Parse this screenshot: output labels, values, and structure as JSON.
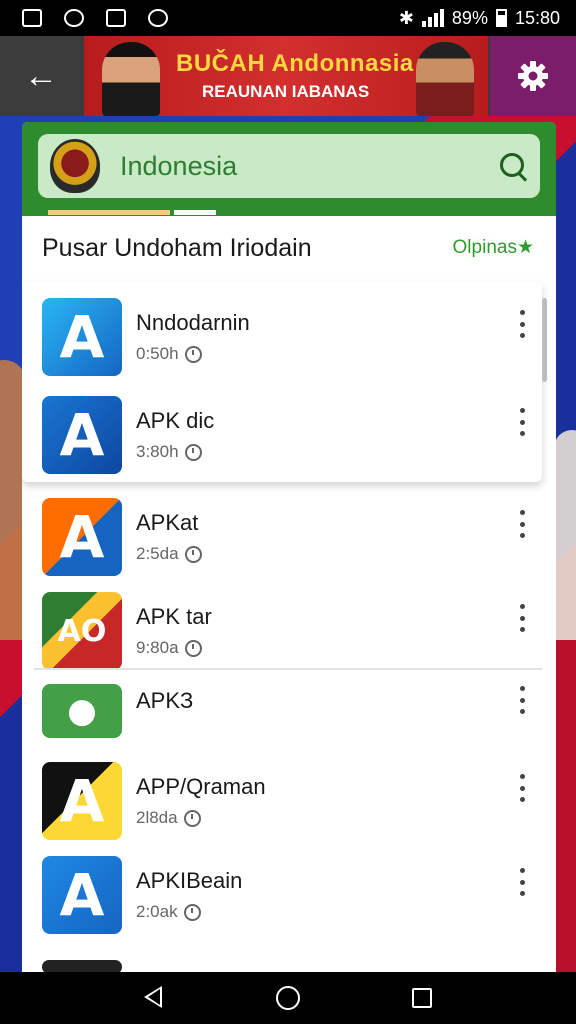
{
  "status_bar": {
    "battery_text": "89%",
    "time": "15:80"
  },
  "app_bar": {
    "banner_title": "BUČAH Andonnasia",
    "banner_subtitle": "REAUNAN IABANAS",
    "back_icon": "arrow-left-icon",
    "settings_icon": "gear-icon"
  },
  "search": {
    "value": "Indonesia",
    "icon": "search-icon"
  },
  "section": {
    "title": "Pusar Undoham Iriodain",
    "action": "Olpinas★"
  },
  "apps": [
    {
      "name": "Nndodarnin",
      "meta": "0:50h",
      "colors": [
        "#1565c0",
        "#29b6f6"
      ],
      "glyph": "A"
    },
    {
      "name": "APK dic",
      "meta": "3:80h",
      "colors": [
        "#1976d2",
        "#0d47a1"
      ],
      "glyph": "A"
    },
    {
      "name": "APKat",
      "meta": "2:5da",
      "colors": [
        "#ff6d00",
        "#1565c0"
      ],
      "glyph": "A"
    },
    {
      "name": "APK tar",
      "meta": "9:80a",
      "colors": [
        "#2e7d32",
        "#c62828"
      ],
      "glyph": "AO"
    },
    {
      "name": "APKЗ",
      "meta": "",
      "colors": [
        "#43a047",
        "#2e7d32"
      ],
      "glyph": "●"
    },
    {
      "name": "APP/Qraman",
      "meta": "2l8da",
      "colors": [
        "#111111",
        "#fdd835"
      ],
      "glyph": "A"
    },
    {
      "name": "APKIBeain",
      "meta": "2:0ak",
      "colors": [
        "#1565c0",
        "#1e88e5"
      ],
      "glyph": "A"
    }
  ],
  "nav": {
    "back": "nav-back-icon",
    "home": "nav-home-icon",
    "recents": "nav-recents-icon"
  }
}
